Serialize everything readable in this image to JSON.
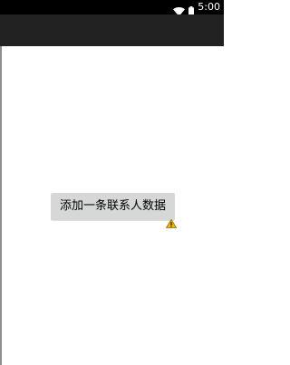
{
  "status_bar": {
    "time": "5:00",
    "wifi_icon": "wifi-icon",
    "battery_icon": "battery-icon"
  },
  "main": {
    "button_label": "添加一条联系人数据",
    "warning_icon": "warning-icon"
  },
  "colors": {
    "status_bar": "#000000",
    "app_bar": "#212121",
    "background": "#ffffff",
    "button": "#d6d7d7",
    "warning": "#f2b800"
  }
}
